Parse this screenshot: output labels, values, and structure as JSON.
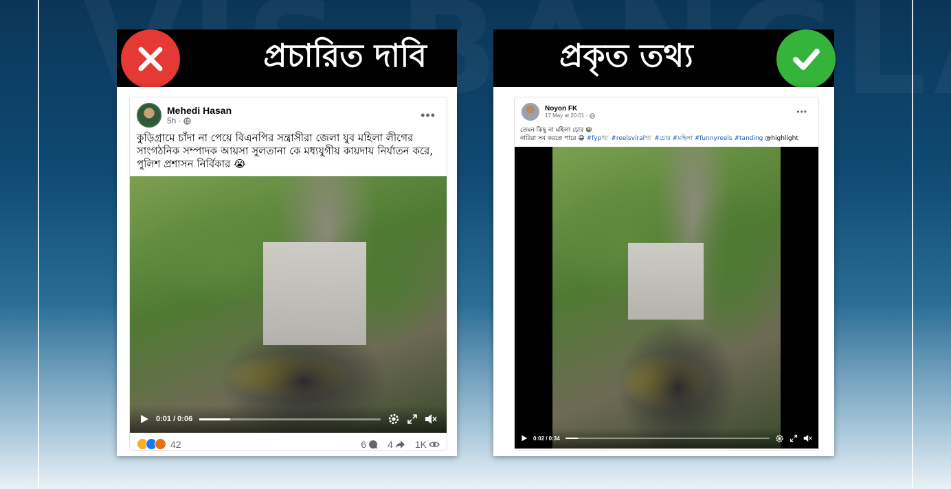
{
  "left_panel": {
    "banner_text": "প্রচারিত দাবি",
    "badge_icon": "cross-icon",
    "post": {
      "author": "Mehedi Hasan",
      "time": "5h ·",
      "caption": "কুড়িগ্রামে চাঁদা না পেয়ে বিএনপির সন্ত্রাসীরা জেলা যুব মহিলা লীগের সাংগঠনিক সম্পাদক আয়সা সুলতানা কে মধ্যযুগীয় কায়দায় নির্যাতন করে, পুলিশ প্রশাসন নির্বিকার 😭",
      "video_time": "0:01 / 0:06",
      "progress": 0.17,
      "reactions_count": "42",
      "comments": "6",
      "shares": "4",
      "views": "1K"
    }
  },
  "right_panel": {
    "banner_text": "প্রকৃত তথ্য",
    "badge_icon": "check-icon",
    "post": {
      "author": "Noyon FK",
      "time": "17 May at 20:01 ·",
      "caption_line1": "তেমন কিছু না মহিলা চোর 😀",
      "caption_line2": "নারিরা সব করতে পারে 😀",
      "hashtags": "#fyp🕊️ #reelsviral🕊️ #চোর #মহিলা #funnyreels #tanding",
      "mention": "@highlight",
      "video_time": "0:02 / 0:34",
      "progress": 0.06
    }
  },
  "colors": {
    "cross": "#e53935",
    "check": "#36b33a",
    "background_top": "#0b3558"
  }
}
